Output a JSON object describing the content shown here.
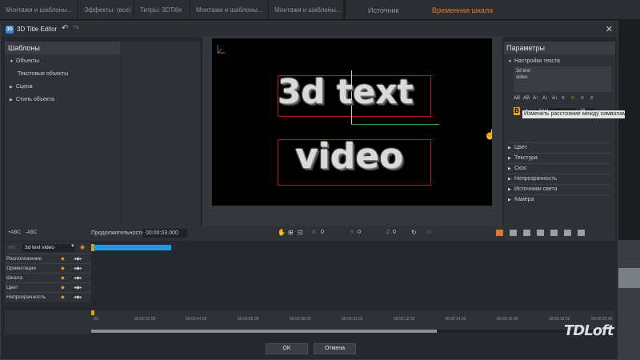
{
  "app": {
    "tabs": [
      "Монтажи и шаблоны...",
      "Эффекты: (все)",
      "Титры: 3DTitle",
      "Монтажи и шаблоны...",
      "Монтажи и шаблоны..."
    ],
    "right_tabs": [
      "Источник",
      "Временная шкала"
    ]
  },
  "dialog": {
    "title": "3D Title Editor",
    "icon_text": "3D"
  },
  "templates": {
    "header": "Шаблоны",
    "items": [
      "Объекты",
      "Текстовые объекты",
      "Сцена",
      "Стиль объекта"
    ]
  },
  "preview": {
    "line1": "3d text",
    "line2": "video"
  },
  "params": {
    "header": "Параметры",
    "text_settings": "Настройки текста",
    "text_line1": "3d text",
    "text_line2": "video",
    "format_buttons": [
      "AB",
      "AB",
      "A↑",
      "A↕",
      "A↕",
      "≡",
      "≡",
      "≡",
      "≡"
    ],
    "color_button": "B",
    "italic_button": "I",
    "font": "Arial",
    "size": "36",
    "tooltip": "Изменить расстояние между символами",
    "sections": [
      "Цвет",
      "Текстура",
      "Скос",
      "Непрозрачность",
      "Источники света",
      "Камера"
    ]
  },
  "timeline": {
    "add_text_label": "+ABC",
    "remove_text_label": "-ABC",
    "duration_label": "Продолжительность",
    "duration_value": "00:00:03.000",
    "x_label": "X:",
    "x_value": "0",
    "y_label": "Y:",
    "y_value": "0",
    "z_label": "Z:",
    "z_value": "0",
    "track_select": "3d text video",
    "track_prefix": "ABC",
    "tracks": [
      "Расположение",
      "Ориентация",
      "Шкала",
      "Цвет",
      "Непрозрачность"
    ],
    "ticks": [
      ";00",
      "00:00:02.00",
      "00:00:04.00",
      "00:00:06.00",
      "00:00:08.00",
      "00:00:10.00",
      "00:00:12.00",
      "00:00:14.00",
      "00:00:16.00",
      "00:00:18.00",
      "00:00:20.00"
    ],
    "scroll_fraction": 0.66
  },
  "buttons": {
    "ok": "OK",
    "cancel": "Отмена"
  },
  "watermark": "TDLoft",
  "colors": {
    "accent": "#1b9be0",
    "keyframe": "#e59b2b",
    "swatch": "#f2a51a"
  }
}
